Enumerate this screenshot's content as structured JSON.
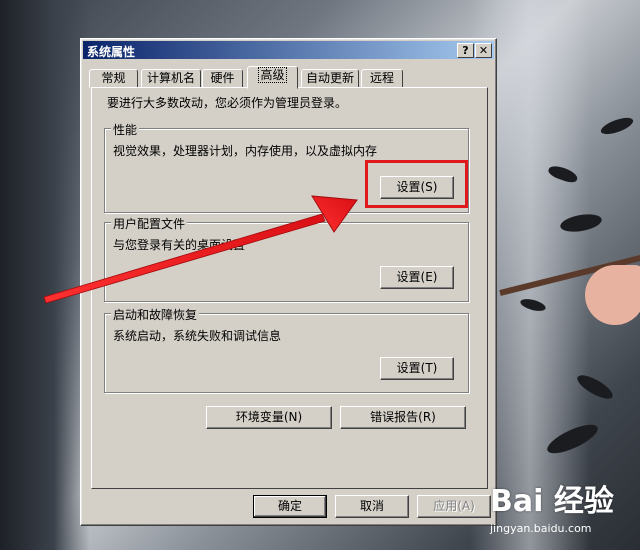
{
  "dialog": {
    "title": "系统属性",
    "help_glyph": "?",
    "close_glyph": "✕",
    "tabs": [
      {
        "label": "常规"
      },
      {
        "label": "计算机名"
      },
      {
        "label": "硬件"
      },
      {
        "label": "高级"
      },
      {
        "label": "自动更新"
      },
      {
        "label": "远程"
      }
    ],
    "active_tab": "高级",
    "note": "要进行大多数改动，您必须作为管理员登录。",
    "performance": {
      "label": "性能",
      "desc": "视觉效果，处理器计划，内存使用，以及虚拟内存",
      "button": "设置(S)"
    },
    "profiles": {
      "label": "用户配置文件",
      "desc": "与您登录有关的桌面设置",
      "button": "设置(E)"
    },
    "startup": {
      "label": "启动和故障恢复",
      "desc": "系统启动，系统失败和调试信息",
      "button": "设置(T)"
    },
    "env_button": "环境变量(N)",
    "error_button": "错误报告(R)",
    "ok_button": "确定",
    "cancel_button": "取消",
    "apply_button": "应用(A)"
  },
  "watermark": {
    "logo": "Bai 经验",
    "url": "jingyan.baidu.com"
  },
  "colors": {
    "title_start": "#0a246a",
    "title_end": "#a6caf0",
    "dialog_face": "#d4d0c8",
    "annotation_red": "#e0171c"
  }
}
